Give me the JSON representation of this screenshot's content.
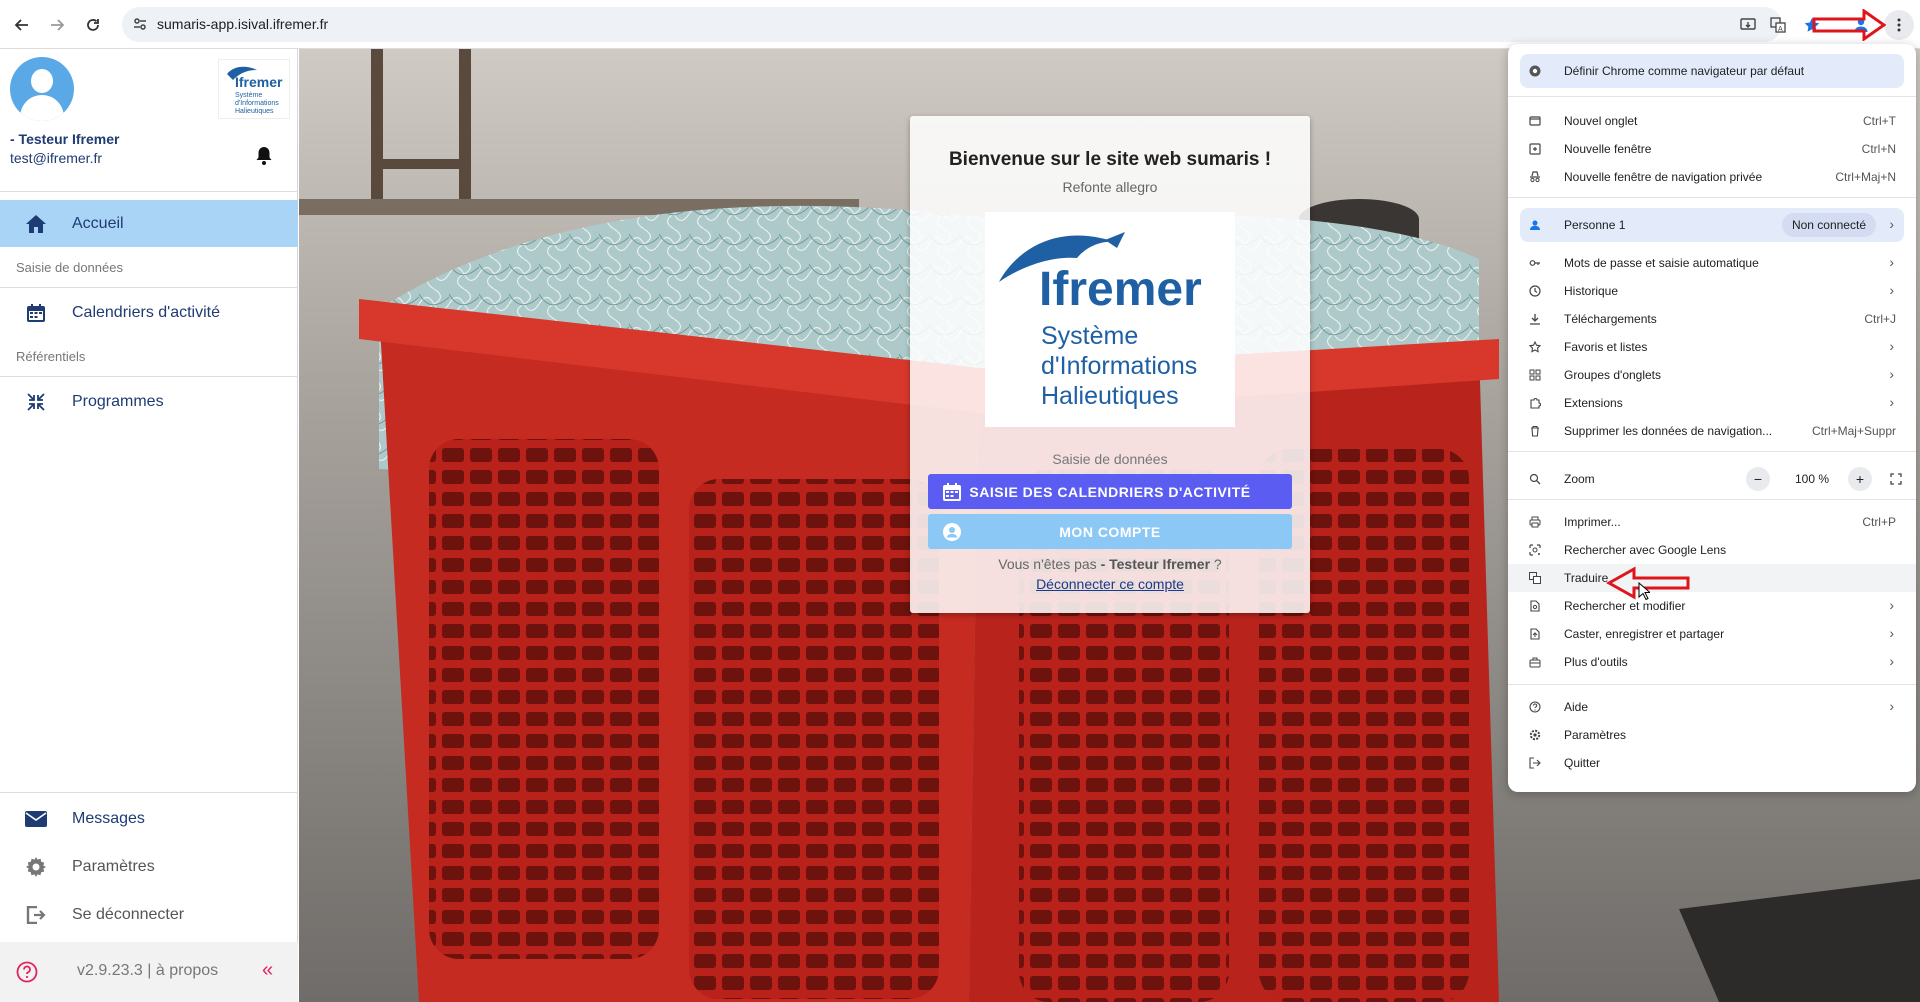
{
  "browser": {
    "url": "sumaris-app.isival.ifremer.fr"
  },
  "sidebar": {
    "user_name": "- Testeur Ifremer",
    "user_email": "test@ifremer.fr",
    "logo_text": "Ifremer",
    "logo_sub1": "Système",
    "logo_sub2": "d'Informations",
    "logo_sub3": "Halieutiques",
    "home": "Accueil",
    "section_data": "Saisie de données",
    "calendars": "Calendriers d'activité",
    "section_ref": "Référentiels",
    "programs": "Programmes",
    "messages": "Messages",
    "settings": "Paramètres",
    "logout": "Se déconnecter",
    "version": "v2.9.23.3 | à propos"
  },
  "card": {
    "title": "Bienvenue sur le site web sumaris !",
    "subtitle": "Refonte allegro",
    "logo_text": "Ifremer",
    "logo_line1": "Système",
    "logo_line2": "d'Informations",
    "logo_line3": "Halieutiques",
    "section": "Saisie de données",
    "btn_calendars": "SAISIE DES CALENDRIERS D'ACTIVITÉ",
    "btn_account": "MON COMPTE",
    "not_you_prefix": "Vous n'êtes pas ",
    "not_you_name": "- Testeur Ifremer",
    "not_you_suffix": " ?",
    "logout_link": "Déconnecter ce compte"
  },
  "chrome_menu": {
    "default_browser": "Définir Chrome comme navigateur par défaut",
    "new_tab": "Nouvel onglet",
    "new_tab_sc": "Ctrl+T",
    "new_window": "Nouvelle fenêtre",
    "new_window_sc": "Ctrl+N",
    "incognito": "Nouvelle fenêtre de navigation privée",
    "incognito_sc": "Ctrl+Maj+N",
    "profile": "Personne 1",
    "profile_status": "Non connecté",
    "passwords": "Mots de passe et saisie automatique",
    "history": "Historique",
    "downloads": "Téléchargements",
    "downloads_sc": "Ctrl+J",
    "bookmarks": "Favoris et listes",
    "tab_groups": "Groupes d'onglets",
    "extensions": "Extensions",
    "clear_data": "Supprimer les données de navigation...",
    "clear_data_sc": "Ctrl+Maj+Suppr",
    "zoom": "Zoom",
    "zoom_minus": "−",
    "zoom_value": "100 %",
    "zoom_plus": "+",
    "print": "Imprimer...",
    "print_sc": "Ctrl+P",
    "lens": "Rechercher avec Google Lens",
    "translate": "Traduire",
    "find_edit": "Rechercher et modifier",
    "cast": "Caster, enregistrer et partager",
    "more_tools": "Plus d'outils",
    "help": "Aide",
    "settings": "Paramètres",
    "quit": "Quitter"
  },
  "colors": {
    "sidebar_active": "#aad4f5",
    "btn_calendars": "#5b5cf2",
    "btn_account": "#8cc8f5",
    "brand_blue": "#1f5fa3",
    "annotation_red": "#e0141b"
  }
}
